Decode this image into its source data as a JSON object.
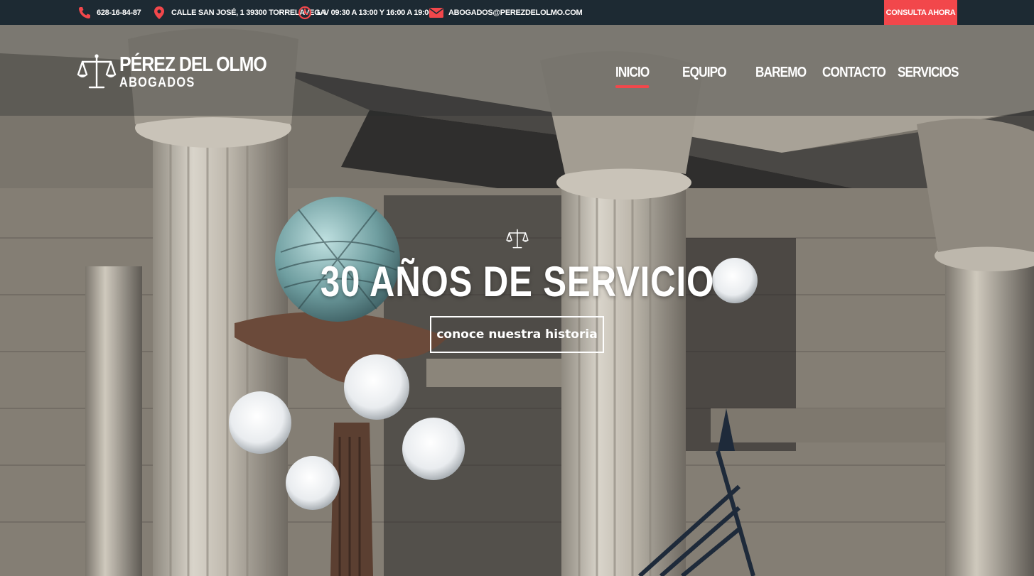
{
  "topbar": {
    "phone": "628-16-84-87",
    "address": "CALLE SAN JOSÉ, 1 39300 TORRELAVEGA",
    "hours": "L-V 09:30 A 13:00 Y 16:00 A 19:00",
    "email": "ABOGADOS@PEREZDELOLMO.COM",
    "cta_label": "CONSULTA AHORA",
    "icons": [
      "phone-icon",
      "map-pin-icon",
      "clock-icon",
      "envelope-icon"
    ],
    "icon_color": "#f2474b",
    "background": "#1d2a33"
  },
  "logo": {
    "brand": "PÉREZ DEL OLMO",
    "subtitle": "ABOGADOS",
    "icon": "scales-of-justice-icon"
  },
  "nav": {
    "items": [
      {
        "label": "INICIO",
        "active": true
      },
      {
        "label": "EQUIPO",
        "active": false
      },
      {
        "label": "BAREMO",
        "active": false
      },
      {
        "label": "CONTACTO",
        "active": false
      },
      {
        "label": "SERVICIOS",
        "active": false
      }
    ]
  },
  "hero": {
    "icon": "scales-of-justice-icon",
    "title": "30 AÑOS DE SERVICIO",
    "button_label": "conoce nuestra historia"
  },
  "colors": {
    "accent": "#f2474b",
    "text": "#ffffff"
  }
}
